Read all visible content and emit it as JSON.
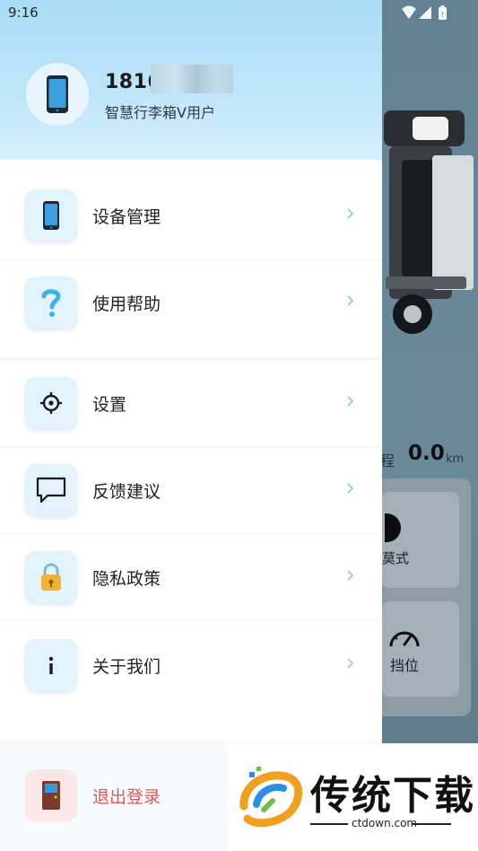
{
  "status_bar": {
    "time": "9:16",
    "icons": [
      "wifi-icon",
      "signal-icon",
      "battery-icon"
    ]
  },
  "background_app": {
    "mileage_label": "里程",
    "mileage_label_visible": "程",
    "mileage_value": "0.0",
    "mileage_unit": "km",
    "mode_label_visible": "莫式",
    "gear_label": "挡位"
  },
  "drawer": {
    "user": {
      "phone_visible": "1816",
      "subtitle": "智慧行李箱V用户"
    },
    "menu": [
      {
        "label": "设备管理",
        "icon": "phone-icon"
      },
      {
        "label": "使用帮助",
        "icon": "question-icon"
      },
      {
        "label": "设置",
        "icon": "settings-icon"
      },
      {
        "label": "反馈建议",
        "icon": "chat-icon"
      },
      {
        "label": "隐私政策",
        "icon": "lock-icon"
      },
      {
        "label": "关于我们",
        "icon": "info-icon"
      }
    ],
    "logout": {
      "label": "退出登录",
      "icon": "door-icon"
    }
  },
  "watermark": {
    "title": "传统下载",
    "url": "ctdown.com"
  },
  "colors": {
    "accent": "#2fa3d8",
    "header_bg": "#bfe6fa",
    "logout_red": "#e35656",
    "icon_bg": "#e3f3fb"
  }
}
